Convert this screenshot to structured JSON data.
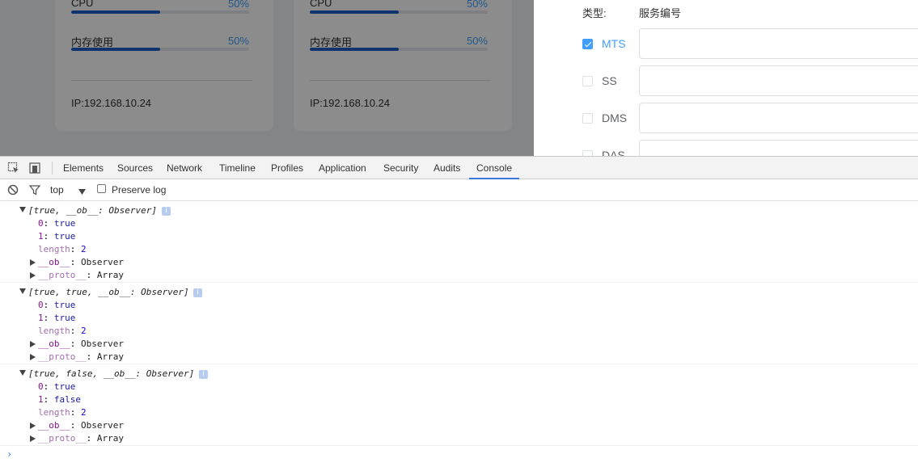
{
  "cards": [
    {
      "cpu_label": "CPU",
      "cpu_percent": "50%",
      "cpu_fill": 0.5,
      "mem_label": "内存使用",
      "mem_percent": "50%",
      "mem_fill": 0.5,
      "ip": "IP:192.168.10.24"
    },
    {
      "cpu_label": "CPU",
      "cpu_percent": "50%",
      "cpu_fill": 0.5,
      "mem_label": "内存使用",
      "mem_percent": "50%",
      "mem_fill": 0.5,
      "ip": "IP:192.168.10.24"
    }
  ],
  "service_form": {
    "type_label": "类型:",
    "number_label": "服务编号",
    "services": [
      {
        "name": "MTS",
        "checked": true
      },
      {
        "name": "SS",
        "checked": false
      },
      {
        "name": "DMS",
        "checked": false
      },
      {
        "name": "DAS",
        "checked": false
      }
    ]
  },
  "devtools": {
    "tabs": [
      "Elements",
      "Sources",
      "Network",
      "Timeline",
      "Profiles",
      "Application",
      "Security",
      "Audits",
      "Console"
    ],
    "active_tab": "Console",
    "toolbar": {
      "context": "top",
      "preserve_log_label": "Preserve log",
      "preserve_log_checked": false
    },
    "logs": [
      {
        "summary": "[true, __ob__: Observer]",
        "entries": [
          {
            "key": "0",
            "value": "true"
          },
          {
            "key": "1",
            "value": "true"
          },
          {
            "key": "length",
            "value": "2"
          },
          {
            "key": "__ob__",
            "value": "Observer"
          },
          {
            "key": "__proto__",
            "value": "Array"
          }
        ]
      },
      {
        "summary": "[true, true, __ob__: Observer]",
        "entries": [
          {
            "key": "0",
            "value": "true"
          },
          {
            "key": "1",
            "value": "true"
          },
          {
            "key": "length",
            "value": "2"
          },
          {
            "key": "__ob__",
            "value": "Observer"
          },
          {
            "key": "__proto__",
            "value": "Array"
          }
        ]
      },
      {
        "summary": "[true, false, __ob__: Observer]",
        "entries": [
          {
            "key": "0",
            "value": "true"
          },
          {
            "key": "1",
            "value": "false"
          },
          {
            "key": "length",
            "value": "2"
          },
          {
            "key": "__ob__",
            "value": "Observer"
          },
          {
            "key": "__proto__",
            "value": "Array"
          }
        ]
      }
    ],
    "prompt_symbol": "›"
  },
  "colors": {
    "accent": "#409eff",
    "progress_fill": "#1a5ec7",
    "active_tab_underline": "#3879d9",
    "console_key": "#881391",
    "console_bool": "#1a1aa6"
  },
  "icons": [
    "inspect-element-icon",
    "device-mode-icon",
    "clear-console-icon",
    "filter-icon",
    "dropdown-arrow-icon",
    "info-icon",
    "expand-triangle-icon",
    "console-prompt-icon"
  ]
}
